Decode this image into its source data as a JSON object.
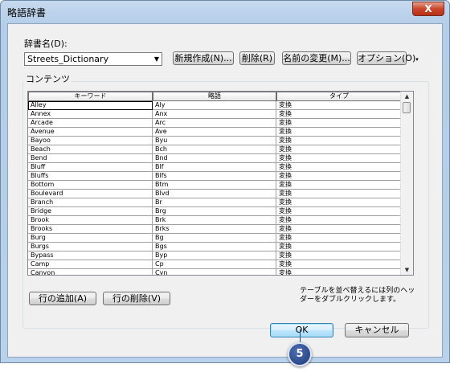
{
  "window": {
    "title": "略語辞書",
    "close_glyph": "X"
  },
  "dictionary": {
    "label": "辞書名(D):",
    "selected": "Streets_Dictionary",
    "buttons": {
      "new": "新規作成(N)...",
      "delete": "削除(R)",
      "rename": "名前の変更(M)...",
      "options": "オプション(O)"
    }
  },
  "contents": {
    "label": "コンテンツ",
    "columns": [
      "キーワード",
      "略語",
      "タイプ"
    ],
    "rows": [
      [
        "Alley",
        "Aly",
        "変換"
      ],
      [
        "Annex",
        "Anx",
        "変換"
      ],
      [
        "Arcade",
        "Arc",
        "変換"
      ],
      [
        "Avenue",
        "Ave",
        "変換"
      ],
      [
        "Bayoo",
        "Byu",
        "変換"
      ],
      [
        "Beach",
        "Bch",
        "変換"
      ],
      [
        "Bend",
        "Bnd",
        "変換"
      ],
      [
        "Bluff",
        "Blf",
        "変換"
      ],
      [
        "Bluffs",
        "Blfs",
        "変換"
      ],
      [
        "Bottom",
        "Btm",
        "変換"
      ],
      [
        "Boulevard",
        "Blvd",
        "変換"
      ],
      [
        "Branch",
        "Br",
        "変換"
      ],
      [
        "Bridge",
        "Brg",
        "変換"
      ],
      [
        "Brook",
        "Brk",
        "変換"
      ],
      [
        "Brooks",
        "Brks",
        "変換"
      ],
      [
        "Burg",
        "Bg",
        "変換"
      ],
      [
        "Burgs",
        "Bgs",
        "変換"
      ],
      [
        "Bypass",
        "Byp",
        "変換"
      ],
      [
        "Camp",
        "Cp",
        "変換"
      ],
      [
        "Canyon",
        "Cyn",
        "変換"
      ]
    ]
  },
  "row_buttons": {
    "add": "行の追加(A)",
    "remove": "行の削除(V)"
  },
  "hint": "テーブルを並べ替えるには列のヘッダーをダブルクリックします。",
  "footer": {
    "ok": "OK",
    "cancel": "キャンセル"
  },
  "callout": {
    "number": "5"
  }
}
